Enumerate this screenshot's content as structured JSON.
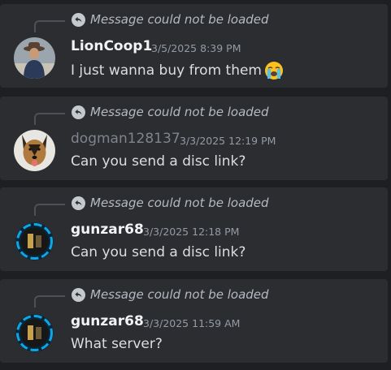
{
  "messages": [
    {
      "reply_text": "Message could not be loaded",
      "username": "LionCoop1",
      "timestamp": "3/5/2025 8:39 PM",
      "text": "I just wanna buy from them",
      "avatar_icon": "avatar-cowboy-icon",
      "emoji_icon": "loudly-crying-face-icon"
    },
    {
      "reply_text": "Message could not be loaded",
      "username": "dogman128137",
      "timestamp": "3/3/2025 12:19 PM",
      "text": "Can you send a disc link?",
      "avatar_icon": "avatar-dog-icon"
    },
    {
      "reply_text": "Message could not be loaded",
      "username": "gunzar68",
      "timestamp": "3/3/2025 12:18 PM",
      "text": "Can you send a disc link?",
      "avatar_icon": "avatar-portal-icon"
    },
    {
      "reply_text": "Message could not be loaded",
      "username": "gunzar68",
      "timestamp": "3/3/2025 11:59 AM",
      "text": "What server?",
      "avatar_icon": "avatar-portal-icon"
    }
  ],
  "colors": {
    "background": "#1e1f22",
    "card": "#2b2d31",
    "username": "#f2f3f5",
    "username_muted": "#80848e",
    "timestamp": "#949ba4",
    "message_text": "#dbdee1",
    "reply_text": "#b5bac1",
    "avatar_ring": "#0ea5e9"
  }
}
